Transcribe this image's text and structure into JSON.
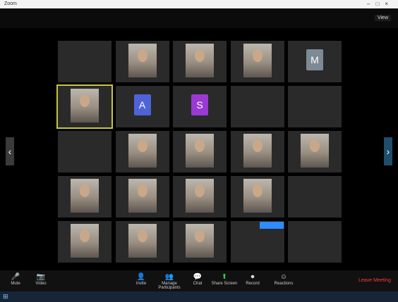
{
  "window": {
    "app_title": "Zoom",
    "buttons": [
      "–",
      "□",
      "×"
    ]
  },
  "topbar": {
    "meeting_info": "",
    "view_label": "View"
  },
  "participants": [
    {
      "name": "",
      "type": "name",
      "label": ""
    },
    {
      "name": "",
      "type": "video",
      "label": ""
    },
    {
      "name": "",
      "type": "video",
      "label": ""
    },
    {
      "name": "",
      "type": "video",
      "label": ""
    },
    {
      "name": "",
      "type": "avatar",
      "initial": "M",
      "color": "#7d8a95",
      "label": ""
    },
    {
      "name": "",
      "type": "video",
      "label": "",
      "active": true
    },
    {
      "name": "",
      "type": "avatar",
      "initial": "A",
      "color": "#4f63d8",
      "label": ""
    },
    {
      "name": "",
      "type": "avatar",
      "initial": "S",
      "color": "#9a3ad2",
      "label": ""
    },
    {
      "name": "",
      "type": "name",
      "label": ""
    },
    {
      "name": "",
      "type": "name",
      "label": ""
    },
    {
      "name": "",
      "type": "name",
      "label": ""
    },
    {
      "name": "",
      "type": "video",
      "label": ""
    },
    {
      "name": "",
      "type": "video",
      "label": ""
    },
    {
      "name": "",
      "type": "video",
      "label": ""
    },
    {
      "name": "",
      "type": "video",
      "label": ""
    },
    {
      "name": "",
      "type": "video",
      "label": ""
    },
    {
      "name": "",
      "type": "video",
      "label": ""
    },
    {
      "name": "",
      "type": "video",
      "label": ""
    },
    {
      "name": "",
      "type": "video",
      "label": ""
    },
    {
      "name": "",
      "type": "name",
      "label": ""
    },
    {
      "name": "",
      "type": "video",
      "label": ""
    },
    {
      "name": "",
      "type": "video",
      "label": ""
    },
    {
      "name": "",
      "type": "video",
      "label": ""
    },
    {
      "name": "",
      "type": "name",
      "label": ""
    },
    {
      "name": "",
      "type": "name",
      "label": ""
    }
  ],
  "toolbar": {
    "mute": "Mute",
    "video": "Video",
    "invite": "Invite",
    "manage_participants": "Manage Participants",
    "chat": "Chat",
    "share_screen": "Share Screen",
    "record": "Record",
    "reactions": "Reactions",
    "leave": "Leave Meeting"
  },
  "taskbar": {
    "start": "⊞",
    "clock": ""
  }
}
